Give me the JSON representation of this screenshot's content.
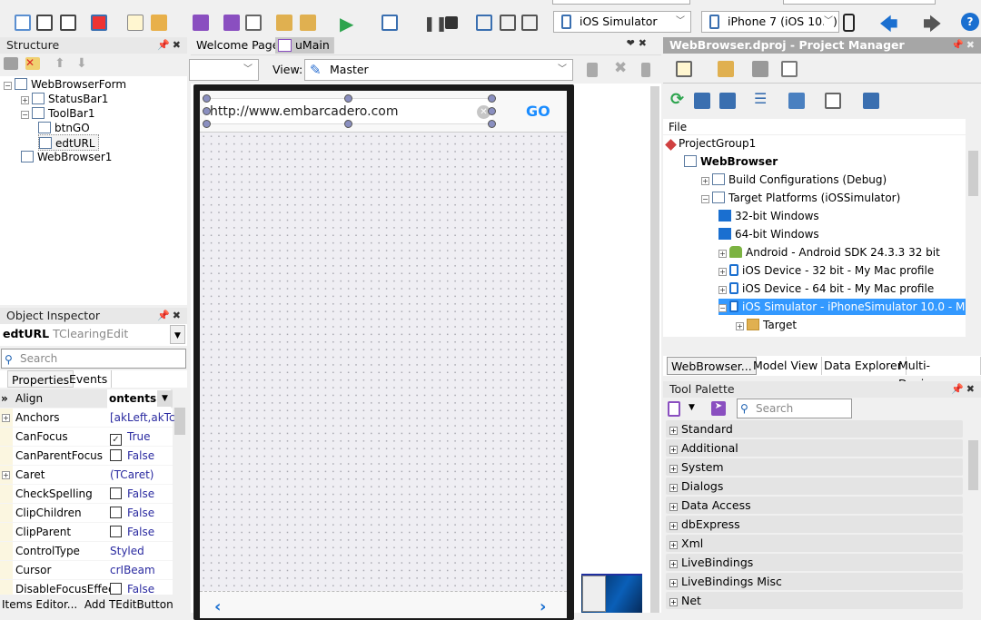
{
  "toolbar": {
    "platform": "iOS Simulator",
    "device": "iPhone 7 (iOS 10.0)"
  },
  "structure": {
    "title": "Structure",
    "items": [
      {
        "label": "WebBrowserForm",
        "level": 0
      },
      {
        "label": "StatusBar1",
        "level": 1
      },
      {
        "label": "ToolBar1",
        "level": 1
      },
      {
        "label": "btnGO",
        "level": 2
      },
      {
        "label": "edtURL",
        "level": 2
      },
      {
        "label": "WebBrowser1",
        "level": 1
      }
    ]
  },
  "inspector": {
    "title": "Object Inspector",
    "object_name": "edtURL",
    "object_type": "TClearingEdit",
    "search_placeholder": "Search",
    "tabs": [
      "Properties",
      "Events"
    ],
    "rows": [
      {
        "name": "Align",
        "value": "ontents",
        "kind": "dropdown"
      },
      {
        "name": "Anchors",
        "value": "[akLeft,akTc",
        "expand": true
      },
      {
        "name": "CanFocus",
        "value": "True",
        "check": true
      },
      {
        "name": "CanParentFocus",
        "value": "False",
        "check": false
      },
      {
        "name": "Caret",
        "value": "(TCaret)",
        "expand": true
      },
      {
        "name": "CheckSpelling",
        "value": "False",
        "check": false
      },
      {
        "name": "ClipChildren",
        "value": "False",
        "check": false
      },
      {
        "name": "ClipParent",
        "value": "False",
        "check": false
      },
      {
        "name": "ControlType",
        "value": "Styled"
      },
      {
        "name": "Cursor",
        "value": "crIBeam"
      },
      {
        "name": "DisableFocusEffec",
        "value": "False",
        "check": false
      }
    ],
    "footer": [
      "Items Editor...",
      "Add TEditButton"
    ]
  },
  "editor": {
    "tabs": [
      "Welcome Page",
      "uMain"
    ],
    "view_label": "View:",
    "view_value": "Master",
    "url": "http://www.embarcadero.com",
    "go": "GO"
  },
  "project": {
    "title": "WebBrowser.dproj - Project Manager",
    "column": "File",
    "items": [
      {
        "label": "ProjectGroup1",
        "level": 0
      },
      {
        "label": "WebBrowser",
        "level": 1,
        "bold": true
      },
      {
        "label": "Build Configurations (Debug)",
        "level": 2
      },
      {
        "label": "Target Platforms (iOSSimulator)",
        "level": 2
      },
      {
        "label": "32-bit Windows",
        "level": 3
      },
      {
        "label": "64-bit Windows",
        "level": 3
      },
      {
        "label": "Android - Android SDK 24.3.3 32 bit",
        "level": 3
      },
      {
        "label": "iOS Device - 32 bit - My Mac profile",
        "level": 3
      },
      {
        "label": "iOS Device - 64 bit - My Mac profile",
        "level": 3
      },
      {
        "label": "iOS Simulator - iPhoneSimulator 10.0 - M...",
        "level": 3,
        "selected": true
      },
      {
        "label": "Target",
        "level": 4
      }
    ],
    "tabs": [
      "WebBrowser...",
      "Model View",
      "Data Explorer",
      "Multi-Device..."
    ]
  },
  "palette": {
    "title": "Tool Palette",
    "search_placeholder": "Search",
    "categories": [
      "Standard",
      "Additional",
      "System",
      "Dialogs",
      "Data Access",
      "dbExpress",
      "Xml",
      "LiveBindings",
      "LiveBindings Misc",
      "Net"
    ]
  },
  "colors": {
    "selection": "#3399ff",
    "go": "#1a8cff",
    "run": "#2da44e"
  }
}
